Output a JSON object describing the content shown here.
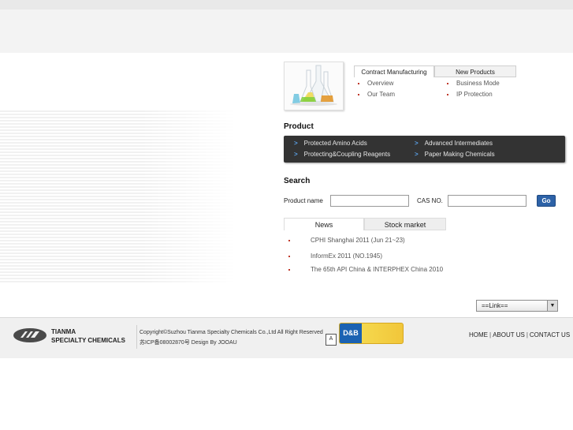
{
  "tabs": {
    "contract": {
      "label": "Contract Manufacturing",
      "items": [
        "Overview",
        "Our Team"
      ]
    },
    "new_products": {
      "label": "New Products",
      "items": [
        "Business Mode",
        "IP Protection"
      ]
    }
  },
  "product": {
    "title": "Product",
    "links": [
      "Protected Amino Acids",
      "Protecting&Coupling Reagents",
      "Advanced Intermediates",
      "Paper Making Chemicals"
    ]
  },
  "search": {
    "title": "Search",
    "product_name_label": "Product name",
    "cas_label": "CAS NO.",
    "product_name_value": "",
    "cas_value": "",
    "go_label": "Go"
  },
  "news_tabs": {
    "news_label": "News",
    "stock_label": "Stock market",
    "items": [
      "CPHI Shanghai 2011 (Jun 21~23)",
      "InformEx 2011 (NO.1945)",
      "The 65th API China & INTERPHEX China 2010"
    ]
  },
  "link_select": {
    "selected": "==Link=="
  },
  "footer": {
    "logo_line1": "TIANMA",
    "logo_line2": "SPECIALTY CHEMICALS",
    "copyright_line1": "Copyright©Suzhou Tianma Specialty Chemicals Co.,Ltd All Right Reserved",
    "copyright_line2": "苏ICP备08002870号 Design By JOOAU",
    "dnb_label": "D&B",
    "links": [
      "HOME",
      "ABOUT US",
      "CONTACT US"
    ]
  },
  "colors": {
    "accent_blue": "#2d62a7",
    "bullet_red": "#c0392b",
    "product_box": "#333333",
    "arrow_blue": "#5aa0e6"
  }
}
